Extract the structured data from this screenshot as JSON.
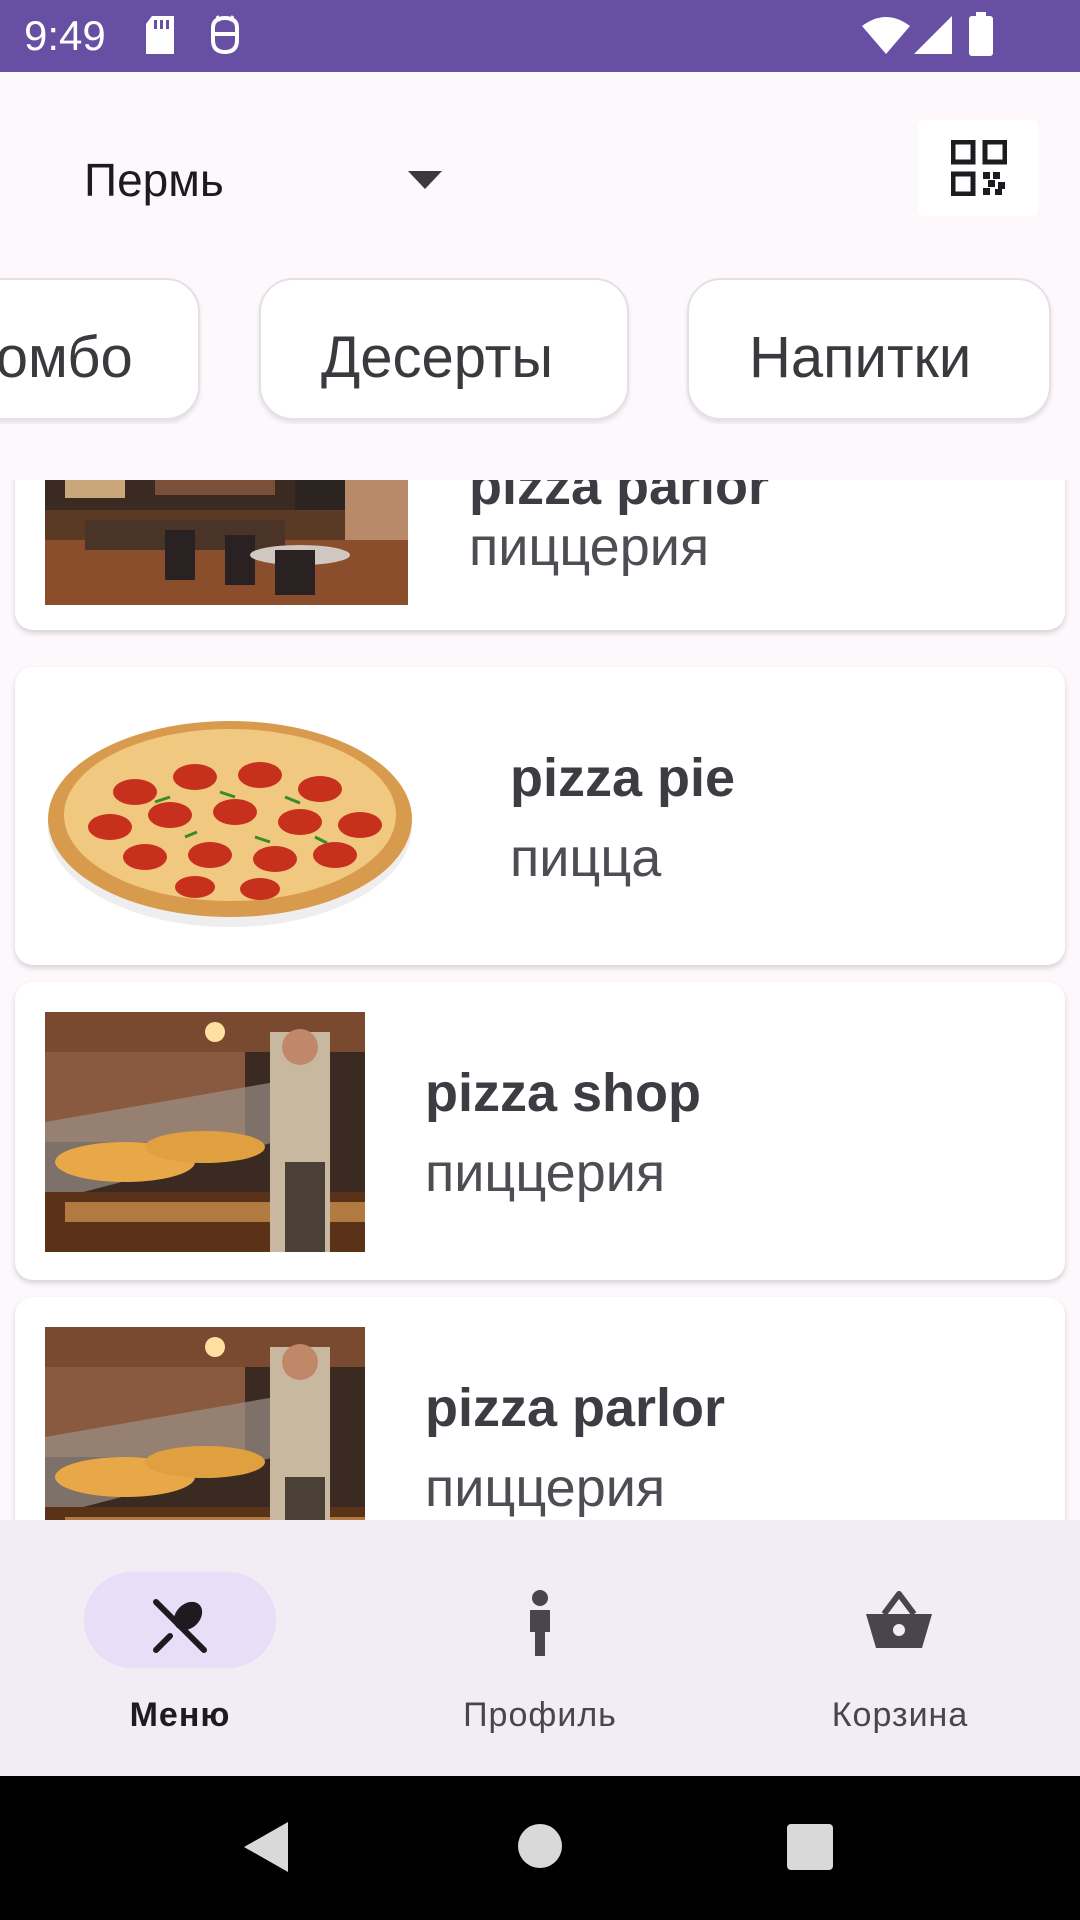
{
  "status_bar": {
    "time": "9:49",
    "icons": [
      "sd-card-icon",
      "android-debug-icon",
      "wifi-icon",
      "signal-icon",
      "battery-icon"
    ],
    "background": "#6750a4"
  },
  "header": {
    "city": "Пермь",
    "qr_icon": "qr-code-icon"
  },
  "categories": {
    "chips": [
      {
        "label": "Комбо"
      },
      {
        "label": "Десерты"
      },
      {
        "label": "Напитки"
      }
    ]
  },
  "restaurants": {
    "items": [
      {
        "title": "pizza parlor",
        "subtitle": "пиццерия",
        "image": "restaurant-interior"
      },
      {
        "title": "pizza pie",
        "subtitle": "пицца",
        "image": "pepperoni-pizza"
      },
      {
        "title": "pizza shop",
        "subtitle": "пиццерия",
        "image": "pizza-counter"
      },
      {
        "title": "pizza parlor",
        "subtitle": "пиццерия",
        "image": "pizza-counter"
      }
    ]
  },
  "bottom_nav": {
    "items": [
      {
        "label": "Меню",
        "icon": "fork-spoon-icon",
        "active": true
      },
      {
        "label": "Профиль",
        "icon": "person-icon",
        "active": false
      },
      {
        "label": "Корзина",
        "icon": "basket-icon",
        "active": false
      }
    ]
  },
  "system_nav": {
    "buttons": [
      "back-icon",
      "home-icon",
      "recents-icon"
    ]
  },
  "colors": {
    "accent": "#6750a4",
    "nav_active_pill": "#e8def8",
    "nav_background": "#f2ecf4"
  }
}
